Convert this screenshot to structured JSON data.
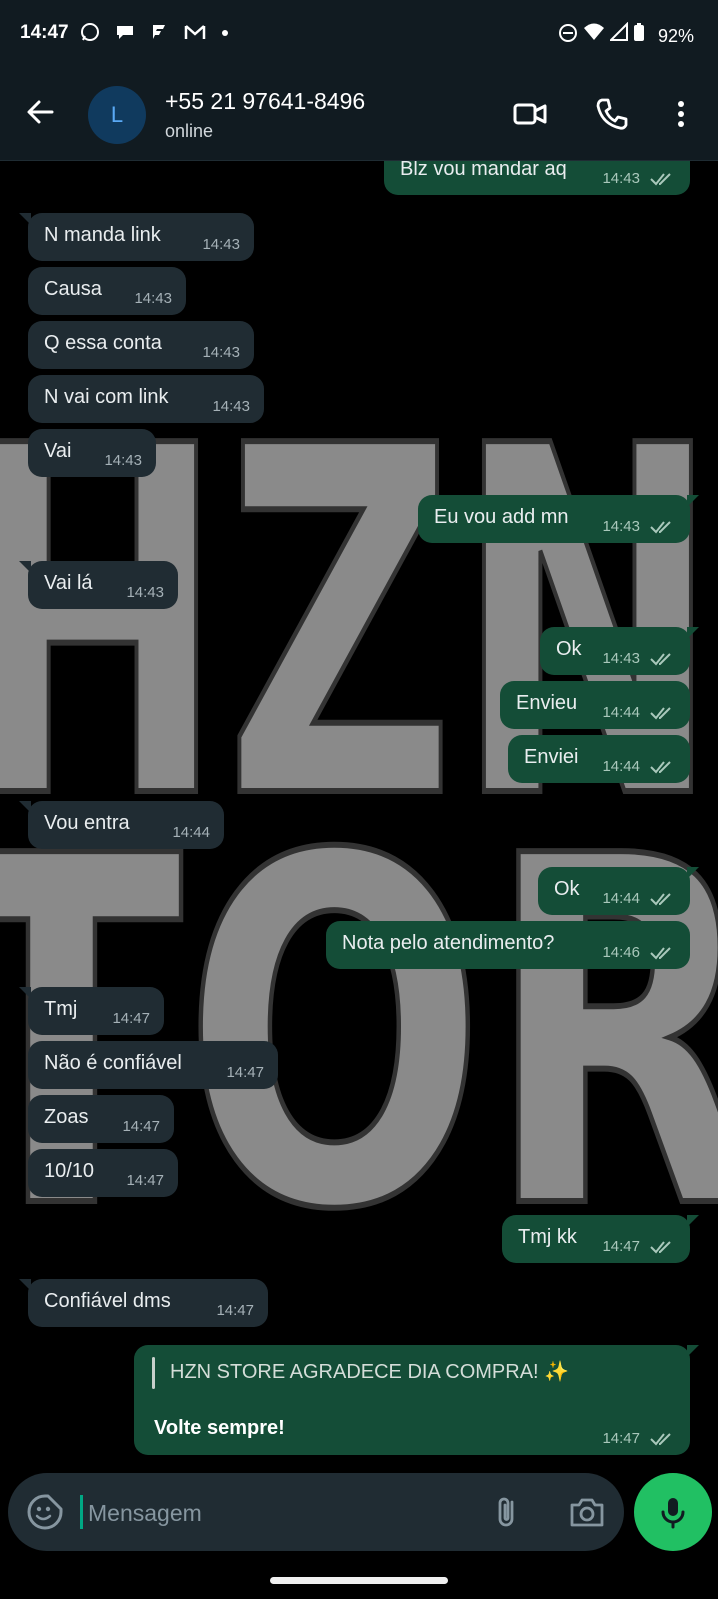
{
  "status_bar": {
    "time": "14:47",
    "left_icons": [
      "whatsapp-icon",
      "chat-icon",
      "f-icon",
      "gmail-icon",
      "dot-icon"
    ],
    "battery": "92%"
  },
  "header": {
    "avatar_letter": "L",
    "contact_name": "+55 21 97641-8496",
    "contact_status": "online"
  },
  "messages": [
    {
      "dir": "out",
      "text": "Blz vou mandar aq",
      "time": "14:43"
    },
    {
      "dir": "in",
      "text": "N manda link",
      "time": "14:43"
    },
    {
      "dir": "in",
      "text": "Causa",
      "time": "14:43"
    },
    {
      "dir": "in",
      "text": "Q essa conta",
      "time": "14:43"
    },
    {
      "dir": "in",
      "text": "N vai com link",
      "time": "14:43"
    },
    {
      "dir": "in",
      "text": "Vai",
      "time": "14:43"
    },
    {
      "dir": "out",
      "text": "Eu vou add mn",
      "time": "14:43"
    },
    {
      "dir": "in",
      "text": "Vai lá",
      "time": "14:43"
    },
    {
      "dir": "out",
      "text": "Ok",
      "time": "14:43"
    },
    {
      "dir": "out",
      "text": "Envieu",
      "time": "14:44"
    },
    {
      "dir": "out",
      "text": "Enviei",
      "time": "14:44"
    },
    {
      "dir": "in",
      "text": "Vou entra",
      "time": "14:44"
    },
    {
      "dir": "out",
      "text": "Ok",
      "time": "14:44"
    },
    {
      "dir": "out",
      "text": "Nota pelo atendimento?",
      "time": "14:46"
    },
    {
      "dir": "in",
      "text": "Tmj",
      "time": "14:47"
    },
    {
      "dir": "in",
      "text": "Não é confiável",
      "time": "14:47"
    },
    {
      "dir": "in",
      "text": "Zoas",
      "time": "14:47"
    },
    {
      "dir": "in",
      "text": "10/10",
      "time": "14:47"
    },
    {
      "dir": "out",
      "text": "Tmj kk",
      "time": "14:47"
    },
    {
      "dir": "in",
      "text": "Confiável dms",
      "time": "14:47"
    }
  ],
  "final_message": {
    "quote": "HZN STORE AGRADECE DIA COMPRA! ✨",
    "text": "Volte sempre!",
    "time": "14:47"
  },
  "wallpaper_text": [
    "HZN",
    "TOR"
  ],
  "composer": {
    "placeholder": "Mensagem"
  },
  "colors": {
    "incoming": "#202c33",
    "outgoing": "#144d37",
    "mic": "#21c063"
  }
}
